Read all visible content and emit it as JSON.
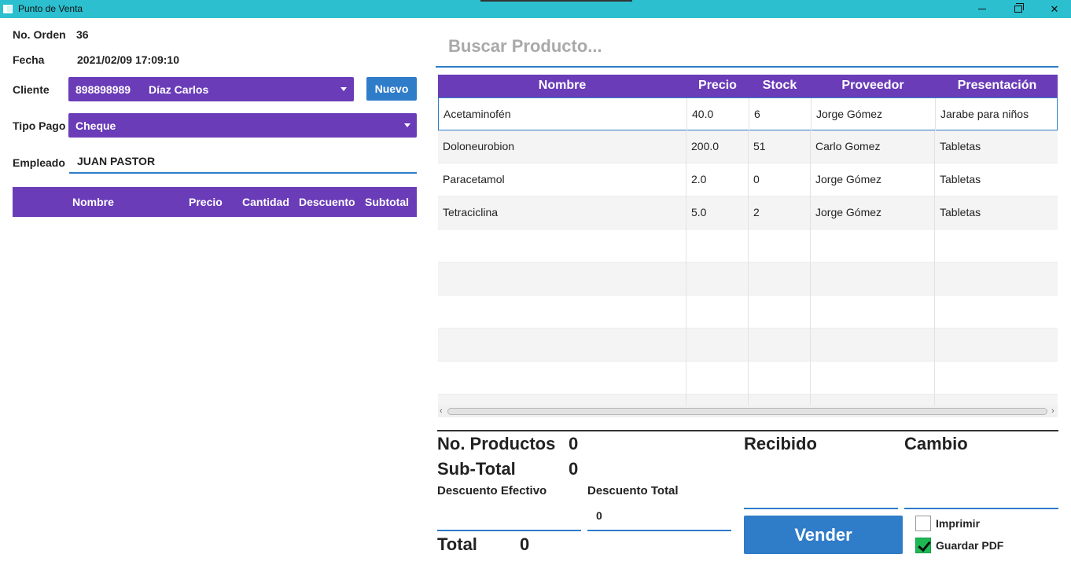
{
  "window": {
    "title": "Punto de Venta",
    "minimize_glyph": "—",
    "maximize_glyph": "❐",
    "close_glyph": "✕"
  },
  "order": {
    "no_label": "No. Orden",
    "no_value": "36",
    "date_label": "Fecha",
    "date_value": "2021/02/09 17:09:10",
    "client_label": "Cliente",
    "client_id": "898898989",
    "client_name": "Díaz Carlos",
    "new_button": "Nuevo",
    "payment_label": "Tipo Pago",
    "payment_value": "Cheque",
    "employee_label": "Empleado",
    "employee_value": "JUAN PASTOR",
    "columns": [
      "Nombre",
      "Precio",
      "Cantidad",
      "Descuento",
      "Subtotal"
    ]
  },
  "search": {
    "placeholder": "Buscar Producto..."
  },
  "products": {
    "columns": [
      "Nombre",
      "Precio",
      "Stock",
      "Proveedor",
      "Presentación"
    ],
    "rows": [
      [
        "Acetaminofén",
        "40.0",
        "6",
        "Jorge Gómez",
        "Jarabe para niños"
      ],
      [
        "Doloneurobion",
        "200.0",
        "51",
        "Carlo Gomez",
        "Tabletas"
      ],
      [
        "Paracetamol",
        "2.0",
        "0",
        "Jorge Gómez",
        "Tabletas"
      ],
      [
        "Tetraciclina",
        "5.0",
        "2",
        "Jorge Gómez",
        "Tabletas"
      ]
    ]
  },
  "summary": {
    "products_label": "No. Productos",
    "products_value": "0",
    "subtotal_label": "Sub-Total",
    "subtotal_value": "0",
    "cash_discount_label": "Descuento Efectivo",
    "total_discount_label": "Descuento Total",
    "total_discount_value": "0",
    "total_label": "Total",
    "total_value": "0",
    "received_label": "Recibido",
    "change_label": "Cambio",
    "sell_button": "Vender",
    "print_label": "Imprimir",
    "print_checked": false,
    "pdf_label": "Guardar PDF",
    "pdf_checked": true
  },
  "colors": {
    "titlebar": "#2bbfcf",
    "purple": "#6a3cb8",
    "blue": "#2f7cc9",
    "check_green": "#1db954"
  }
}
